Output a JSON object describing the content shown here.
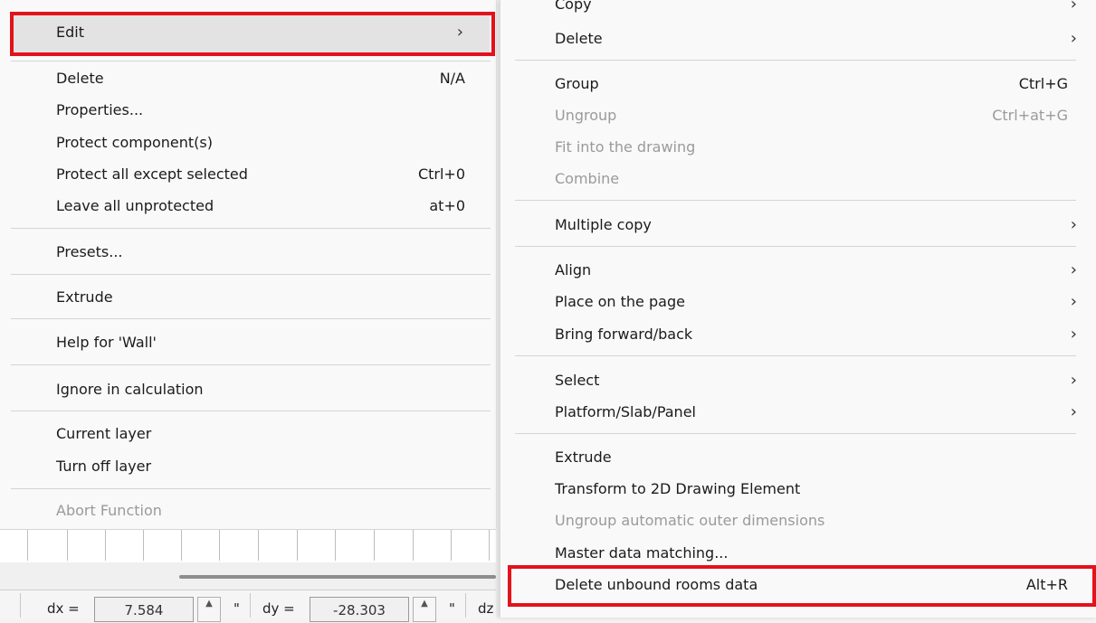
{
  "left_menu": {
    "items": [
      {
        "label": "Edit",
        "arrow": "›",
        "highlighted": true
      },
      {
        "label": "Delete",
        "shortcut": "N/A"
      },
      {
        "label": "Properties..."
      },
      {
        "label": "Protect component(s)"
      },
      {
        "label": "Protect all except selected",
        "shortcut": "Ctrl+0"
      },
      {
        "label": "Leave all unprotected",
        "shortcut": "at+0"
      },
      {
        "label": "Presets..."
      },
      {
        "label": "Extrude"
      },
      {
        "label": "Help for 'Wall'"
      },
      {
        "label": "Ignore in calculation"
      },
      {
        "label": "Current layer"
      },
      {
        "label": "Turn off layer"
      },
      {
        "label": "Abort Function",
        "disabled": true
      }
    ]
  },
  "right_menu": {
    "items": [
      {
        "label": "Copy",
        "arrow": "›"
      },
      {
        "label": "Delete",
        "arrow": "›"
      },
      {
        "label": "Group",
        "shortcut": "Ctrl+G"
      },
      {
        "label": "Ungroup",
        "shortcut": "Ctrl+at+G",
        "disabled": true
      },
      {
        "label": "Fit into the drawing",
        "disabled": true
      },
      {
        "label": "Combine",
        "disabled": true
      },
      {
        "label": "Multiple copy",
        "arrow": "›"
      },
      {
        "label": "Align",
        "arrow": "›"
      },
      {
        "label": "Place on the page",
        "arrow": "›"
      },
      {
        "label": "Bring forward/back",
        "arrow": "›"
      },
      {
        "label": "Select",
        "arrow": "›"
      },
      {
        "label": "Platform/Slab/Panel",
        "arrow": "›"
      },
      {
        "label": "Extrude"
      },
      {
        "label": "Transform to 2D Drawing Element"
      },
      {
        "label": "Ungroup automatic outer dimensions",
        "disabled": true
      },
      {
        "label": "Master data matching..."
      },
      {
        "label": "Delete unbound rooms data",
        "shortcut": "Alt+R",
        "highlighted": true
      }
    ]
  },
  "status_bar": {
    "dx_label": "dx =",
    "dx_value": "7.584",
    "dy_label": "dy =",
    "dy_value": "-28.303",
    "unit_mark": "\"",
    "dz_label_partial": "dz"
  },
  "colors": {
    "highlight_box": "#e3121b",
    "menu_background": "#f9f9f9",
    "disabled_text": "#9a9a9a"
  }
}
